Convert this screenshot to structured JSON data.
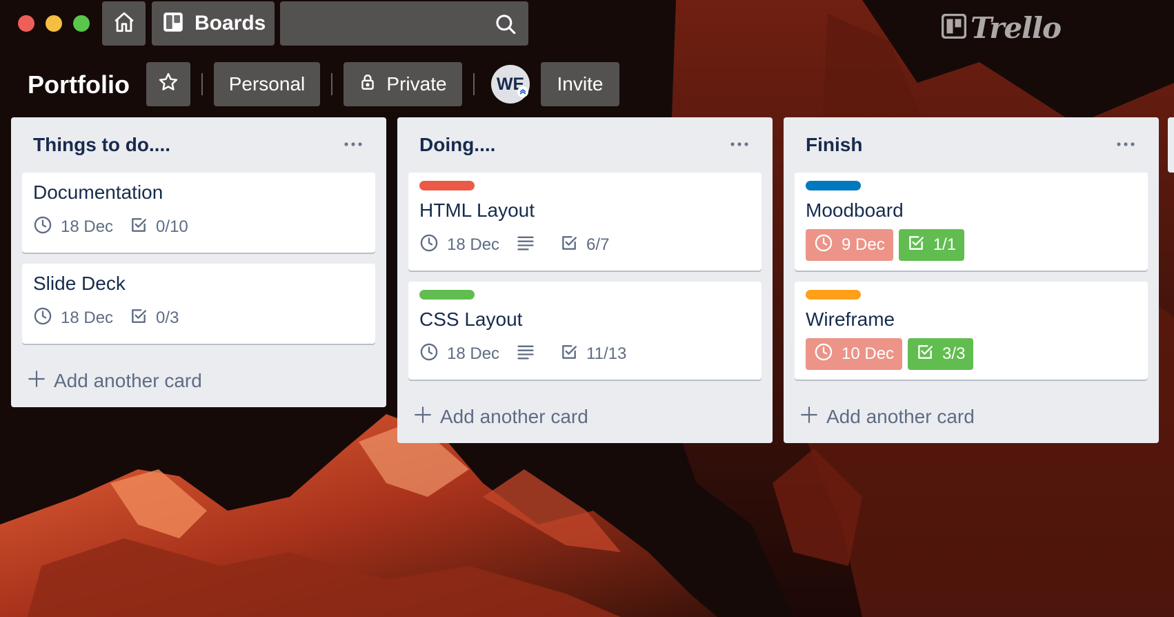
{
  "topbar": {
    "home_icon": "home-icon",
    "boards_label": "Boards",
    "search_value": "",
    "search_placeholder": "",
    "logo_text": "Trello"
  },
  "board": {
    "title": "Portfolio",
    "star_icon": "star-icon",
    "personal_label": "Personal",
    "private_label": "Private",
    "avatar_initials": "WE",
    "invite_label": "Invite"
  },
  "lists": [
    {
      "title": "Things to do....",
      "add_card_label": "Add another card",
      "cards": [
        {
          "title": "Documentation",
          "due": "18 Dec",
          "checklist": "0/10"
        },
        {
          "title": "Slide Deck",
          "due": "18 Dec",
          "checklist": "0/3"
        }
      ]
    },
    {
      "title": "Doing....",
      "add_card_label": "Add another card",
      "cards": [
        {
          "title": "HTML Layout",
          "label_color": "#eb5a46",
          "due": "18 Dec",
          "has_description": true,
          "checklist": "6/7"
        },
        {
          "title": "CSS Layout",
          "label_color": "#61bd4f",
          "due": "18 Dec",
          "has_description": true,
          "checklist": "11/13"
        }
      ]
    },
    {
      "title": "Finish",
      "add_card_label": "Add another card",
      "cards": [
        {
          "title": "Moodboard",
          "label_color": "#0079bf",
          "due": "9 Dec",
          "due_status": "overdue",
          "checklist": "1/1",
          "checklist_complete": true
        },
        {
          "title": "Wireframe",
          "label_color": "#ff9f1a",
          "due": "10 Dec",
          "due_status": "overdue",
          "checklist": "3/3",
          "checklist_complete": true
        }
      ]
    }
  ],
  "colors": {
    "list_bg": "#ebecf0",
    "overdue_badge": "#ec9488",
    "complete_badge": "#61bd4f",
    "text_primary": "#172b4d",
    "text_secondary": "#5e6c84"
  }
}
